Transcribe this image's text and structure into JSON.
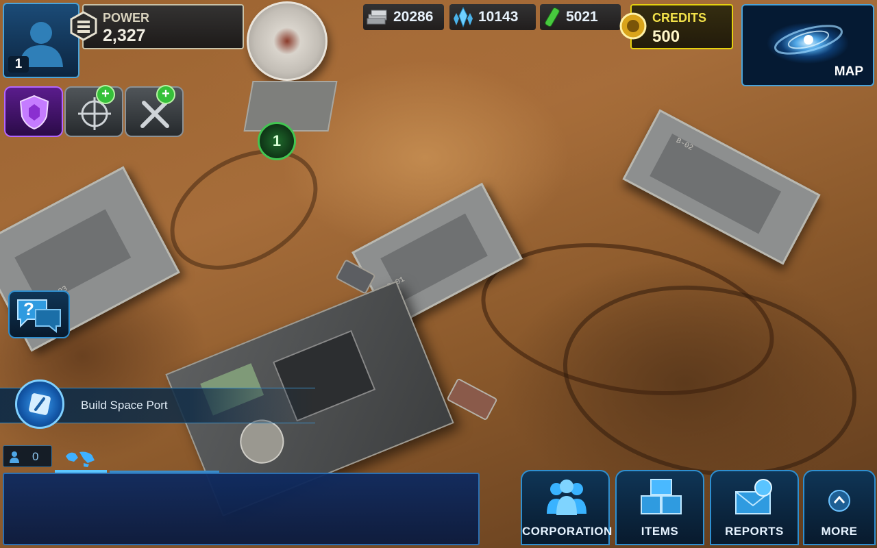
{
  "player": {
    "level": "1"
  },
  "power": {
    "label": "POWER",
    "value": "2,327"
  },
  "resources": [
    {
      "icon": "metal-icon",
      "value": "20286"
    },
    {
      "icon": "crystal-icon",
      "value": "10143"
    },
    {
      "icon": "fuel-icon",
      "value": "5021"
    }
  ],
  "credits": {
    "label": "CREDITS",
    "value": "500"
  },
  "map_button": {
    "label": "MAP"
  },
  "quick_actions": [
    {
      "icon": "shield-icon",
      "name": "shield-button"
    },
    {
      "icon": "crosshair-icon",
      "name": "targeting-button",
      "plus": "+"
    },
    {
      "icon": "tools-icon",
      "name": "repair-button",
      "plus": "+"
    }
  ],
  "radar_badge": "1",
  "bases": [
    {
      "code": "B-03"
    },
    {
      "code": "B-01"
    },
    {
      "code": "B-02"
    }
  ],
  "help_button": {
    "label": "?"
  },
  "mission": {
    "text": "Build Space Port",
    "icon": "build-icon"
  },
  "chat": {
    "online_count": "0",
    "icon": "world-icon"
  },
  "nav": [
    {
      "label": "CORPORATION",
      "icon": "people-icon"
    },
    {
      "label": "ITEMS",
      "icon": "crates-icon"
    },
    {
      "label": "REPORTS",
      "icon": "envelope-icon"
    },
    {
      "label": "MORE",
      "icon": "chevron-up-icon"
    }
  ],
  "colors": {
    "hud_border": "#4aa3d9",
    "credits_border": "#e5d10f",
    "shield_purple": "#8a2fd0",
    "plus_green": "#36c03a"
  }
}
